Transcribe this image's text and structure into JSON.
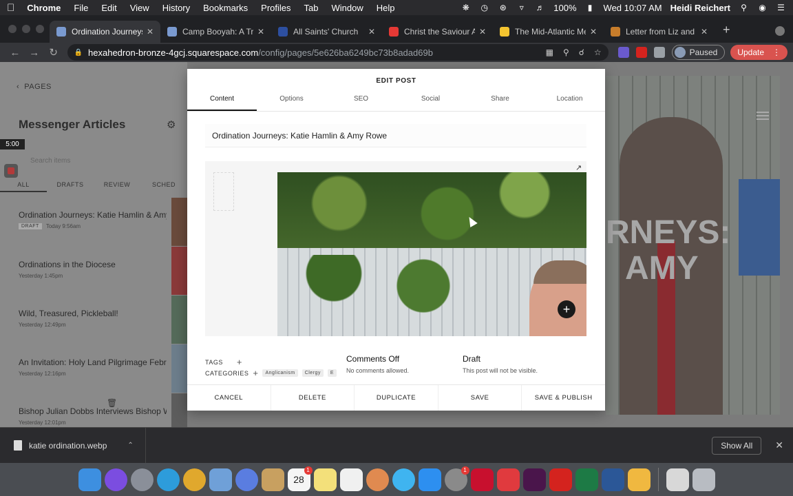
{
  "menubar": {
    "app": "Chrome",
    "items": [
      "File",
      "Edit",
      "View",
      "History",
      "Bookmarks",
      "Profiles",
      "Tab",
      "Window",
      "Help"
    ],
    "battery": "100%",
    "datetime": "Wed 10:07 AM",
    "user": "Heidi Reichert"
  },
  "tabs": [
    {
      "title": "Ordination Journeys",
      "color": "#7a9ad0"
    },
    {
      "title": "Camp Booyah: A Tra",
      "color": "#7a9ad0"
    },
    {
      "title": "All Saints' Church",
      "color": "#2d4fa0"
    },
    {
      "title": "Christ the Saviour A",
      "color": "#e53935"
    },
    {
      "title": "The Mid-Atlantic Me",
      "color": "#f4c430"
    },
    {
      "title": "Letter from Liz and",
      "color": "#c77d2b"
    }
  ],
  "url": {
    "host": "hexahedron-bronze-4gcj.squarespace.com",
    "path": "/config/pages/5e626ba6249bc73b8adad69b"
  },
  "profile": {
    "label": "Paused"
  },
  "update_label": "Update",
  "sidebar": {
    "back": "PAGES",
    "title": "Messenger Articles",
    "timer": "5:00",
    "search_placeholder": "Search items",
    "tabs": [
      "ALL",
      "DRAFTS",
      "REVIEW",
      "SCHED"
    ],
    "posts": [
      {
        "title": "Ordination Journeys: Katie Hamlin & Amy ...",
        "badge": "DRAFT",
        "time": "Today 9:56am"
      },
      {
        "title": "Ordinations in the Diocese",
        "badge": "",
        "time": "Yesterday 1:45pm"
      },
      {
        "title": "Wild, Treasured, Pickleball!",
        "badge": "",
        "time": "Yesterday 12:49pm"
      },
      {
        "title": "An Invitation: Holy Land Pilgrimage Febru...",
        "badge": "",
        "time": "Yesterday 12:16pm"
      },
      {
        "title": "Bishop Julian Dobbs Interviews Bishop W...",
        "badge": "",
        "time": "Yesterday 12:01pm"
      }
    ]
  },
  "background_headline": {
    "line1": "RNEYS:",
    "line2": "AMY"
  },
  "modal": {
    "header": "EDIT POST",
    "tabs": [
      "Content",
      "Options",
      "SEO",
      "Social",
      "Share",
      "Location"
    ],
    "post_title": "Ordination Journeys: Katie Hamlin & Amy Rowe",
    "tags_label": "TAGS",
    "categories_label": "CATEGORIES",
    "categories": [
      "Anglicanism",
      "Clergy",
      "E"
    ],
    "comments_title": "Comments Off",
    "comments_sub": "No comments allowed.",
    "status_title": "Draft",
    "status_sub": "This post will not be visible.",
    "footer": [
      "CANCEL",
      "DELETE",
      "DUPLICATE",
      "SAVE",
      "SAVE & PUBLISH"
    ]
  },
  "downloads": {
    "file": "katie ordination.webp",
    "show_all": "Show All"
  },
  "dock": {
    "apps": [
      {
        "name": "finder",
        "color": "#3d8fe0"
      },
      {
        "name": "siri",
        "color": "#7b4de0"
      },
      {
        "name": "launchpad",
        "color": "#8a8f99"
      },
      {
        "name": "safari",
        "color": "#2d9cdb"
      },
      {
        "name": "chrome",
        "color": "#e0a82d"
      },
      {
        "name": "preview",
        "color": "#6fa0d8"
      },
      {
        "name": "settings-app",
        "color": "#5a7de0"
      },
      {
        "name": "notes-folder",
        "color": "#c8a060"
      },
      {
        "name": "calendar",
        "color": "#f5f5f5",
        "badge": "1",
        "label": "28"
      },
      {
        "name": "notes",
        "color": "#f3e07a"
      },
      {
        "name": "reminders",
        "color": "#f0f0f0"
      },
      {
        "name": "photos",
        "color": "#e08a50"
      },
      {
        "name": "messages",
        "color": "#3fb4f0"
      },
      {
        "name": "app-store",
        "color": "#2d8ff0"
      },
      {
        "name": "system-preferences",
        "color": "#8a8a8a",
        "badge": "1"
      },
      {
        "name": "cdm",
        "color": "#c8102e"
      },
      {
        "name": "creative-cloud",
        "color": "#e03a3e"
      },
      {
        "name": "slack",
        "color": "#4a154b"
      },
      {
        "name": "acrobat",
        "color": "#d4231e"
      },
      {
        "name": "excel",
        "color": "#1d7a45"
      },
      {
        "name": "word",
        "color": "#2b5797"
      },
      {
        "name": "pencil",
        "color": "#f0b840"
      }
    ]
  }
}
